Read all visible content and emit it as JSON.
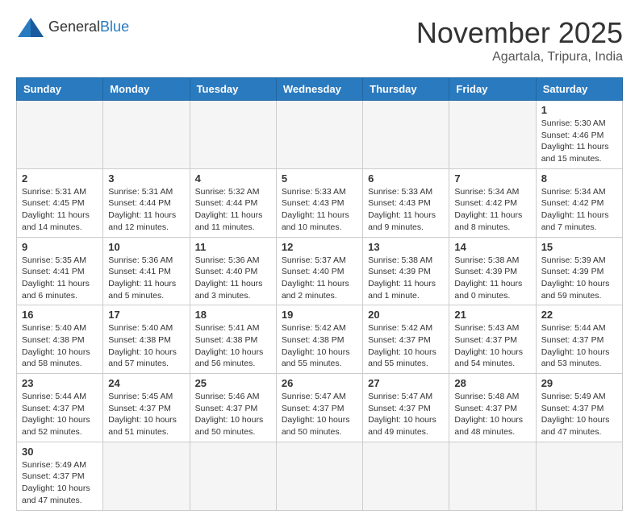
{
  "logo": {
    "text_general": "General",
    "text_blue": "Blue"
  },
  "title": "November 2025",
  "location": "Agartala, Tripura, India",
  "weekdays": [
    "Sunday",
    "Monday",
    "Tuesday",
    "Wednesday",
    "Thursday",
    "Friday",
    "Saturday"
  ],
  "weeks": [
    [
      {
        "day": "",
        "info": ""
      },
      {
        "day": "",
        "info": ""
      },
      {
        "day": "",
        "info": ""
      },
      {
        "day": "",
        "info": ""
      },
      {
        "day": "",
        "info": ""
      },
      {
        "day": "",
        "info": ""
      },
      {
        "day": "1",
        "info": "Sunrise: 5:30 AM\nSunset: 4:46 PM\nDaylight: 11 hours and 15 minutes."
      }
    ],
    [
      {
        "day": "2",
        "info": "Sunrise: 5:31 AM\nSunset: 4:45 PM\nDaylight: 11 hours and 14 minutes."
      },
      {
        "day": "3",
        "info": "Sunrise: 5:31 AM\nSunset: 4:44 PM\nDaylight: 11 hours and 12 minutes."
      },
      {
        "day": "4",
        "info": "Sunrise: 5:32 AM\nSunset: 4:44 PM\nDaylight: 11 hours and 11 minutes."
      },
      {
        "day": "5",
        "info": "Sunrise: 5:33 AM\nSunset: 4:43 PM\nDaylight: 11 hours and 10 minutes."
      },
      {
        "day": "6",
        "info": "Sunrise: 5:33 AM\nSunset: 4:43 PM\nDaylight: 11 hours and 9 minutes."
      },
      {
        "day": "7",
        "info": "Sunrise: 5:34 AM\nSunset: 4:42 PM\nDaylight: 11 hours and 8 minutes."
      },
      {
        "day": "8",
        "info": "Sunrise: 5:34 AM\nSunset: 4:42 PM\nDaylight: 11 hours and 7 minutes."
      }
    ],
    [
      {
        "day": "9",
        "info": "Sunrise: 5:35 AM\nSunset: 4:41 PM\nDaylight: 11 hours and 6 minutes."
      },
      {
        "day": "10",
        "info": "Sunrise: 5:36 AM\nSunset: 4:41 PM\nDaylight: 11 hours and 5 minutes."
      },
      {
        "day": "11",
        "info": "Sunrise: 5:36 AM\nSunset: 4:40 PM\nDaylight: 11 hours and 3 minutes."
      },
      {
        "day": "12",
        "info": "Sunrise: 5:37 AM\nSunset: 4:40 PM\nDaylight: 11 hours and 2 minutes."
      },
      {
        "day": "13",
        "info": "Sunrise: 5:38 AM\nSunset: 4:39 PM\nDaylight: 11 hours and 1 minute."
      },
      {
        "day": "14",
        "info": "Sunrise: 5:38 AM\nSunset: 4:39 PM\nDaylight: 11 hours and 0 minutes."
      },
      {
        "day": "15",
        "info": "Sunrise: 5:39 AM\nSunset: 4:39 PM\nDaylight: 10 hours and 59 minutes."
      }
    ],
    [
      {
        "day": "16",
        "info": "Sunrise: 5:40 AM\nSunset: 4:38 PM\nDaylight: 10 hours and 58 minutes."
      },
      {
        "day": "17",
        "info": "Sunrise: 5:40 AM\nSunset: 4:38 PM\nDaylight: 10 hours and 57 minutes."
      },
      {
        "day": "18",
        "info": "Sunrise: 5:41 AM\nSunset: 4:38 PM\nDaylight: 10 hours and 56 minutes."
      },
      {
        "day": "19",
        "info": "Sunrise: 5:42 AM\nSunset: 4:38 PM\nDaylight: 10 hours and 55 minutes."
      },
      {
        "day": "20",
        "info": "Sunrise: 5:42 AM\nSunset: 4:37 PM\nDaylight: 10 hours and 55 minutes."
      },
      {
        "day": "21",
        "info": "Sunrise: 5:43 AM\nSunset: 4:37 PM\nDaylight: 10 hours and 54 minutes."
      },
      {
        "day": "22",
        "info": "Sunrise: 5:44 AM\nSunset: 4:37 PM\nDaylight: 10 hours and 53 minutes."
      }
    ],
    [
      {
        "day": "23",
        "info": "Sunrise: 5:44 AM\nSunset: 4:37 PM\nDaylight: 10 hours and 52 minutes."
      },
      {
        "day": "24",
        "info": "Sunrise: 5:45 AM\nSunset: 4:37 PM\nDaylight: 10 hours and 51 minutes."
      },
      {
        "day": "25",
        "info": "Sunrise: 5:46 AM\nSunset: 4:37 PM\nDaylight: 10 hours and 50 minutes."
      },
      {
        "day": "26",
        "info": "Sunrise: 5:47 AM\nSunset: 4:37 PM\nDaylight: 10 hours and 50 minutes."
      },
      {
        "day": "27",
        "info": "Sunrise: 5:47 AM\nSunset: 4:37 PM\nDaylight: 10 hours and 49 minutes."
      },
      {
        "day": "28",
        "info": "Sunrise: 5:48 AM\nSunset: 4:37 PM\nDaylight: 10 hours and 48 minutes."
      },
      {
        "day": "29",
        "info": "Sunrise: 5:49 AM\nSunset: 4:37 PM\nDaylight: 10 hours and 47 minutes."
      }
    ],
    [
      {
        "day": "30",
        "info": "Sunrise: 5:49 AM\nSunset: 4:37 PM\nDaylight: 10 hours and 47 minutes."
      },
      {
        "day": "",
        "info": ""
      },
      {
        "day": "",
        "info": ""
      },
      {
        "day": "",
        "info": ""
      },
      {
        "day": "",
        "info": ""
      },
      {
        "day": "",
        "info": ""
      },
      {
        "day": "",
        "info": ""
      }
    ]
  ]
}
